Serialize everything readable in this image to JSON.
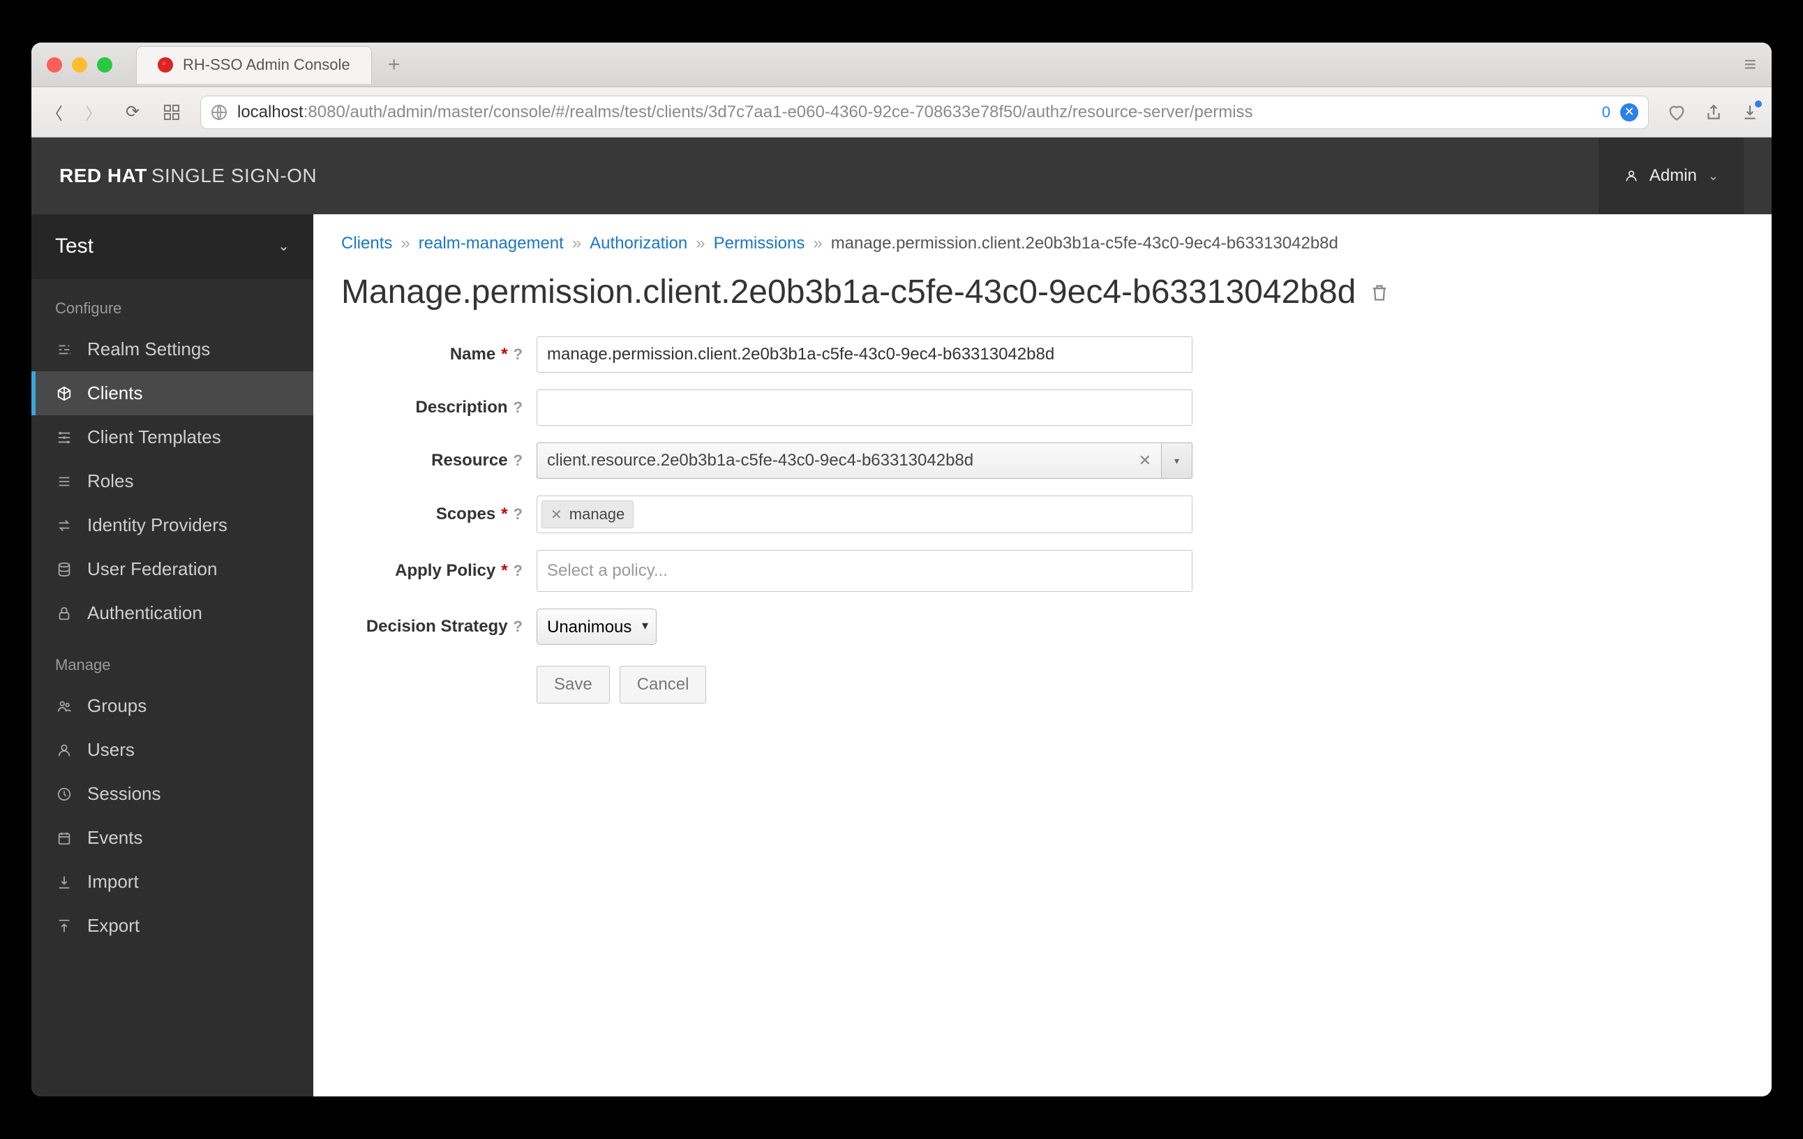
{
  "browser": {
    "tab_title": "RH-SSO Admin Console",
    "url_host": "localhost",
    "url_port": ":8080",
    "url_path": "/auth/admin/master/console/#/realms/test/clients/3d7c7aa1-e060-4360-92ce-708633e78f50/authz/resource-server/permiss",
    "url_badge": "0"
  },
  "header": {
    "brand_bold": "RED HAT",
    "brand_thin": "SINGLE SIGN-ON",
    "user_label": "Admin"
  },
  "sidebar": {
    "realm": "Test",
    "groups": [
      {
        "title": "Configure",
        "items": [
          {
            "icon": "sliders",
            "label": "Realm Settings"
          },
          {
            "icon": "cube",
            "label": "Clients",
            "active": true
          },
          {
            "icon": "templates",
            "label": "Client Templates"
          },
          {
            "icon": "list",
            "label": "Roles"
          },
          {
            "icon": "swap",
            "label": "Identity Providers"
          },
          {
            "icon": "db",
            "label": "User Federation"
          },
          {
            "icon": "lock",
            "label": "Authentication"
          }
        ]
      },
      {
        "title": "Manage",
        "items": [
          {
            "icon": "group",
            "label": "Groups"
          },
          {
            "icon": "user",
            "label": "Users"
          },
          {
            "icon": "clock",
            "label": "Sessions"
          },
          {
            "icon": "calendar",
            "label": "Events"
          },
          {
            "icon": "import",
            "label": "Import"
          },
          {
            "icon": "export",
            "label": "Export"
          }
        ]
      }
    ]
  },
  "breadcrumb": {
    "items": [
      "Clients",
      "realm-management",
      "Authorization",
      "Permissions"
    ],
    "current": "manage.permission.client.2e0b3b1a-c5fe-43c0-9ec4-b63313042b8d"
  },
  "page": {
    "title": "Manage.permission.client.2e0b3b1a-c5fe-43c0-9ec4-b63313042b8d"
  },
  "form": {
    "name": {
      "label": "Name",
      "required": true,
      "value": "manage.permission.client.2e0b3b1a-c5fe-43c0-9ec4-b63313042b8d"
    },
    "description": {
      "label": "Description",
      "value": ""
    },
    "resource": {
      "label": "Resource",
      "value": "client.resource.2e0b3b1a-c5fe-43c0-9ec4-b63313042b8d"
    },
    "scopes": {
      "label": "Scopes",
      "required": true,
      "tags": [
        "manage"
      ]
    },
    "apply_policy": {
      "label": "Apply Policy",
      "required": true,
      "placeholder": "Select a policy..."
    },
    "decision": {
      "label": "Decision Strategy",
      "value": "Unanimous"
    },
    "save_label": "Save",
    "cancel_label": "Cancel"
  }
}
